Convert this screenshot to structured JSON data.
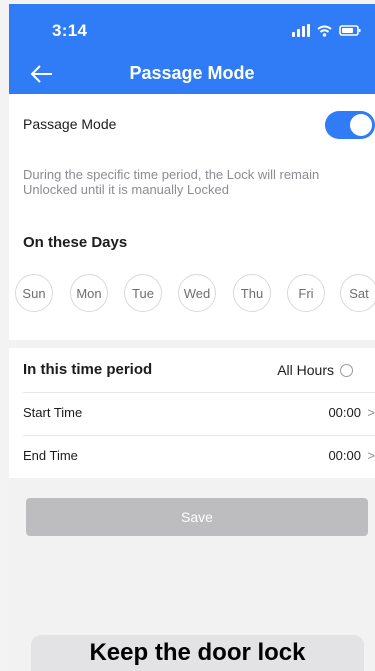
{
  "status_bar": {
    "time": "3:14"
  },
  "header": {
    "title": "Passage Mode"
  },
  "passage_mode": {
    "label": "Passage Mode",
    "enabled": true,
    "description": "During the specific time period, the Lock will remain Unlocked until it is manually Locked"
  },
  "days": {
    "title": "On these Days",
    "items": [
      "Sun",
      "Mon",
      "Tue",
      "Wed",
      "Thu",
      "Fri",
      "Sat"
    ]
  },
  "time_period": {
    "title": "In this time period",
    "all_hours_label": "All Hours",
    "all_hours_selected": false,
    "start_label": "Start Time",
    "start_value": "00:00",
    "end_label": "End Time",
    "end_value": "00:00"
  },
  "actions": {
    "save_label": "Save"
  },
  "caption": {
    "text": "Keep the door lock"
  },
  "colors": {
    "accent": "#2f7cf6",
    "disabled_button": "#bdbdc0"
  },
  "icons": {
    "back": "arrow-left-icon",
    "signal": "signal-icon",
    "wifi": "wifi-icon",
    "battery": "battery-icon",
    "chevron": "chevron-right-icon"
  }
}
